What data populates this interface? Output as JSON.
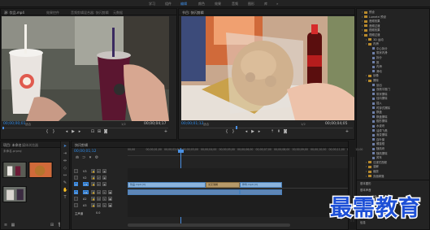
{
  "workspaces": [
    "学习",
    "组件",
    "编辑",
    "颜色",
    "效果",
    "音频",
    "图形",
    "库",
    "»"
  ],
  "active_workspace": "编辑",
  "source_monitor": {
    "tabs": [
      "源: 饮品.mp4",
      "效果控件",
      "音频剪辑混合器: 快闪剪辑",
      "元数据"
    ],
    "timecode": "00;00;00;01",
    "fit": "适合",
    "fraction": "1/2",
    "duration": "00;00;04;17"
  },
  "program_monitor": {
    "tab": "节目: 快闪剪辑",
    "timecode": "00;00;01;12",
    "fit": "适合",
    "fraction": "1/2",
    "duration": "00;00;04;05"
  },
  "effects_panel": {
    "items": [
      {
        "label": "预设",
        "indent": 0,
        "folder": true
      },
      {
        "label": "Lumetri 预设",
        "indent": 0,
        "folder": true
      },
      {
        "label": "音频效果",
        "indent": 0,
        "folder": true
      },
      {
        "label": "音频过渡",
        "indent": 0,
        "folder": true
      },
      {
        "label": "视频效果",
        "indent": 0,
        "folder": true
      },
      {
        "label": "视频过渡",
        "indent": 0,
        "folder": true
      },
      {
        "label": "3D 运动",
        "indent": 1,
        "folder": true
      },
      {
        "label": "内滑",
        "indent": 1,
        "folder": true
      },
      {
        "label": "中心拆分",
        "indent": 2,
        "folder": false
      },
      {
        "label": "带状内滑",
        "indent": 2,
        "folder": false
      },
      {
        "label": "拆分",
        "indent": 2,
        "folder": false
      },
      {
        "label": "推",
        "indent": 2,
        "folder": false
      },
      {
        "label": "内滑",
        "indent": 2,
        "folder": false
      },
      {
        "label": "滑动",
        "indent": 2,
        "folder": false
      },
      {
        "label": "划像",
        "indent": 1,
        "folder": true
      },
      {
        "label": "擦除",
        "indent": 1,
        "folder": true
      },
      {
        "label": "划出",
        "indent": 2,
        "folder": false
      },
      {
        "label": "双侧平推门",
        "indent": 2,
        "folder": false
      },
      {
        "label": "带状擦除",
        "indent": 2,
        "folder": false
      },
      {
        "label": "径向擦除",
        "indent": 2,
        "folder": false
      },
      {
        "label": "插入",
        "indent": 2,
        "folder": false
      },
      {
        "label": "时钟式擦除",
        "indent": 2,
        "folder": false
      },
      {
        "label": "棋盘",
        "indent": 2,
        "folder": false
      },
      {
        "label": "棋盘擦除",
        "indent": 2,
        "folder": false
      },
      {
        "label": "楔形擦除",
        "indent": 2,
        "folder": false
      },
      {
        "label": "水波块",
        "indent": 2,
        "folder": false
      },
      {
        "label": "油漆飞溅",
        "indent": 2,
        "folder": false
      },
      {
        "label": "渐变擦除",
        "indent": 2,
        "folder": false
      },
      {
        "label": "百叶窗",
        "indent": 2,
        "folder": false
      },
      {
        "label": "螺旋框",
        "indent": 2,
        "folder": false
      },
      {
        "label": "随机块",
        "indent": 2,
        "folder": false
      },
      {
        "label": "随机擦除",
        "indent": 2,
        "folder": false
      },
      {
        "label": "风车",
        "indent": 2,
        "folder": false
      },
      {
        "label": "沉浸式视频",
        "indent": 1,
        "folder": true
      },
      {
        "label": "溶解",
        "indent": 1,
        "folder": true
      },
      {
        "label": "缩放",
        "indent": 1,
        "folder": true
      },
      {
        "label": "页面剥落",
        "indent": 1,
        "folder": true
      }
    ],
    "lower_labels": [
      "基本图形",
      "基本声音",
      "Lumetri 颜色",
      "库",
      "标记",
      "历史记录",
      "信息"
    ]
  },
  "project_panel": {
    "tabs": [
      "项目: 未命名",
      "媒体浏览器"
    ],
    "file": "未命名.prproj"
  },
  "timeline": {
    "tab": "快闪剪辑",
    "timecode": "00;00;01;12",
    "ruler": [
      "00;00",
      "00;00;01;00",
      "00;00;02;00",
      "00;00;03;00",
      "00;00;04;00",
      "00;00;05;00",
      "00;00;06;00",
      "00;00;07;00",
      "00;00;08;00",
      "00;00;09;00",
      "00;00;10;00",
      "00;00;11;00",
      "00;00;12;00"
    ],
    "video_tracks": [
      "V3",
      "V2",
      "V1"
    ],
    "audio_tracks": [
      "A1",
      "A2",
      "A3"
    ],
    "master": "主声道",
    "master_value": "0.0",
    "clips": {
      "v1_a": "饮品.mp4 [V]",
      "v1_b": "交叉溶解",
      "v1_c": "炸鸡.mp4 [V]",
      "a1_a": "",
      "a1_b": ""
    }
  },
  "watermark": "最需教育",
  "colors": {
    "accent": "#2d8ceb",
    "playhead": "#4a90e2",
    "clip_video": "#8ab3dc",
    "clip_audio": "#5e86b6"
  }
}
